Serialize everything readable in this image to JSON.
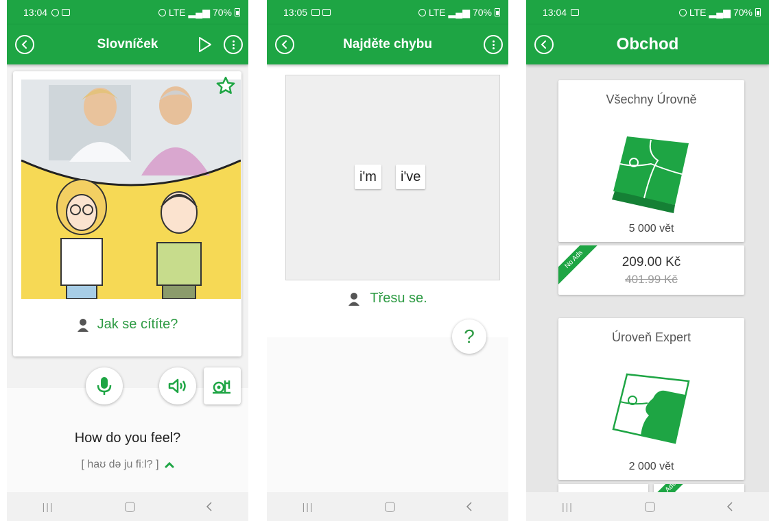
{
  "colors": {
    "brand_green": "#1ea544",
    "text_green": "#2e9b44"
  },
  "screen1": {
    "status": {
      "time": "13:04",
      "network": "LTE",
      "battery": "70%"
    },
    "title": "Slovníček",
    "phrase": "Jak se cítíte?",
    "translation": "How do you feel?",
    "ipa": "[ haʊ də ju fiːl? ]",
    "icons": [
      "back-icon",
      "play-icon",
      "more-icon",
      "star-icon",
      "speaker-person-icon",
      "microphone-icon",
      "speaker-icon",
      "slow-playback-icon",
      "chevron-up-icon"
    ]
  },
  "screen2": {
    "status": {
      "time": "13:05",
      "network": "LTE",
      "battery": "70%"
    },
    "title": "Najděte chybu",
    "chips": [
      "i'm",
      "i've"
    ],
    "sentence": "Třesu se.",
    "hint": "?"
  },
  "screen3": {
    "status": {
      "time": "13:04",
      "network": "LTE",
      "battery": "70%"
    },
    "title": "Obchod",
    "products": [
      {
        "name": "Všechny Úrovně",
        "count": "5 000 vět",
        "price": "209.00 Kč",
        "old_price": "401.99 Kč",
        "badge": "No Ads"
      },
      {
        "name": "Úroveň Expert",
        "count": "2 000 vět",
        "badge": "Ads"
      }
    ]
  }
}
